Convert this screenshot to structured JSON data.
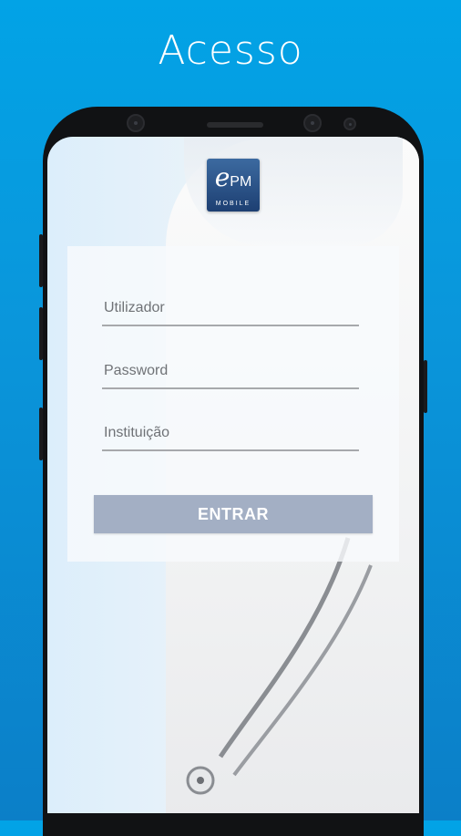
{
  "header": {
    "title": "Acesso"
  },
  "logo": {
    "letter": "e",
    "suffix": "PM",
    "subtitle": "MOBILE"
  },
  "login": {
    "username_placeholder": "Utilizador",
    "password_placeholder": "Password",
    "institution_placeholder": "Instituição",
    "submit_label": "ENTRAR"
  },
  "colors": {
    "background": "#02a3e6",
    "button": "#a3afc4",
    "logo": "#2a5189"
  }
}
